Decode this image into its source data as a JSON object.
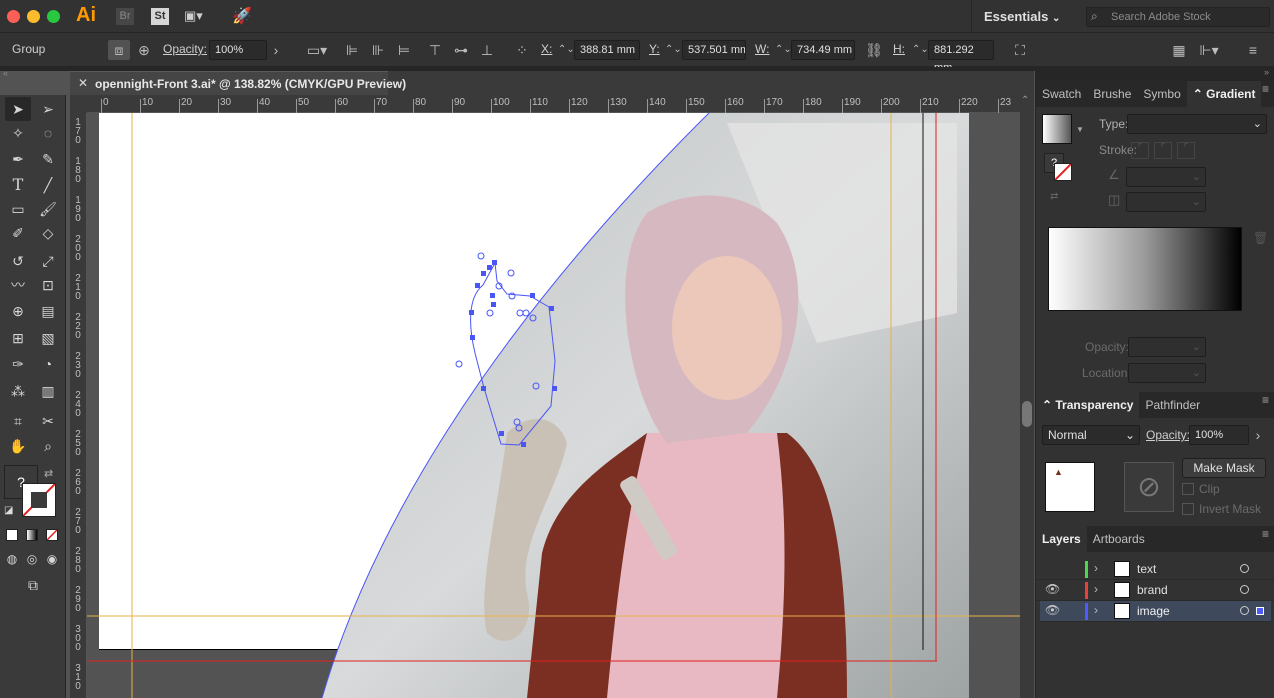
{
  "app": {
    "logo": "Ai",
    "bridge": "Br",
    "stock": "St",
    "workspace": "Essentials",
    "search_placeholder": "Search Adobe Stock"
  },
  "control": {
    "selection_type": "Group",
    "opacity_label": "Opacity:",
    "opacity": "100%",
    "x_label": "X:",
    "x": "388.81 mm",
    "y_label": "Y:",
    "y": "537.501 mm",
    "w_label": "W:",
    "w": "734.49 mm",
    "h_label": "H:",
    "h": "881.292 mm"
  },
  "document": {
    "tab_title": "opennight-Front 3.ai* @ 138.82% (CMYK/GPU Preview)"
  },
  "ruler": {
    "h_ticks": [
      "0",
      "10",
      "20",
      "30",
      "40",
      "50",
      "60",
      "70",
      "80",
      "90",
      "100",
      "110",
      "120",
      "130",
      "140",
      "150",
      "160",
      "170",
      "180",
      "190",
      "200",
      "210",
      "220",
      "23"
    ],
    "v_ticks": [
      "170",
      "180",
      "190",
      "200",
      "210",
      "220",
      "230",
      "240",
      "250",
      "260",
      "270",
      "280",
      "290",
      "300",
      "310"
    ]
  },
  "gradient_panel": {
    "tabs": [
      "Swatch",
      "Brushe",
      "Symbo",
      "Gradient"
    ],
    "active_tab": "Gradient",
    "type_label": "Type:",
    "stroke_label": "Stroke:",
    "opacity_label": "Opacity:",
    "location_label": "Location:"
  },
  "transparency_panel": {
    "tabs": [
      "Transparency",
      "Pathfinder"
    ],
    "blend_mode": "Normal",
    "opacity_label": "Opacity:",
    "opacity": "100%",
    "make_mask": "Make Mask",
    "clip": "Clip",
    "invert_mask": "Invert Mask"
  },
  "layers_panel": {
    "tabs": [
      "Layers",
      "Artboards"
    ],
    "layers": [
      {
        "name": "text",
        "color": "#4fd64f",
        "visible": false,
        "selected": false
      },
      {
        "name": "brand",
        "color": "#e8413c",
        "visible": true,
        "selected": false
      },
      {
        "name": "image",
        "color": "#4f5bff",
        "visible": true,
        "selected": true
      }
    ]
  },
  "colors": {
    "ui_dark": "#323232",
    "guide": "#e6b24a",
    "bleed": "#e02020",
    "selection": "#4a55f5"
  }
}
